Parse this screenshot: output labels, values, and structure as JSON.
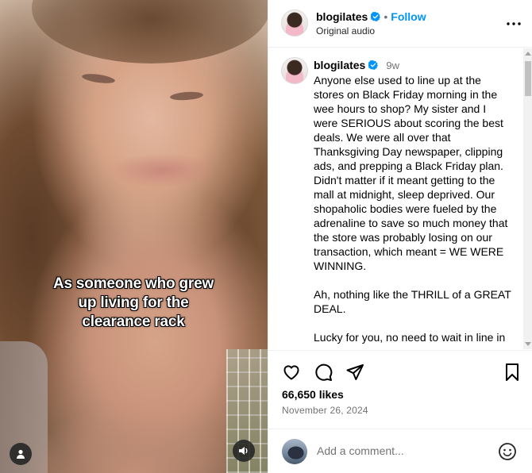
{
  "media": {
    "caption_lines": [
      "As someone who grew",
      "up living for the",
      "clearance rack"
    ],
    "user_icon": "person-icon",
    "sound_icon": "speaker-icon"
  },
  "post_header": {
    "username": "blogilates",
    "separator": "•",
    "follow_label": "Follow",
    "audio_label": "Original audio",
    "more_icon": "more-horizontal-icon"
  },
  "caption": {
    "username": "blogilates",
    "time_ago": "9w",
    "paragraphs": [
      "Anyone else used to line up at the stores on Black Friday morning in the wee hours to shop? My sister and I were SERIOUS about scoring the best deals. We were all over that Thanksgiving Day newspaper, clipping ads, and prepping a Black Friday plan. Didn't matter if it meant getting to the mall at midnight, sleep deprived. Our shopaholic bodies were fueled by the adrenaline to save so much money that the store was probably losing on our transaction, which meant = WE WERE WINNING.",
      "Ah, nothing like the THRILL of a GREAT DEAL.",
      "Lucky for you, no need to wait in line in"
    ]
  },
  "actions": {
    "likes": "66,650 likes",
    "date": "November 26, 2024"
  },
  "comment_box": {
    "placeholder": "Add a comment..."
  },
  "colors": {
    "accent": "#0095f6",
    "verified": "#0095f6",
    "muted_text": "#737373",
    "divider": "#efefef"
  }
}
